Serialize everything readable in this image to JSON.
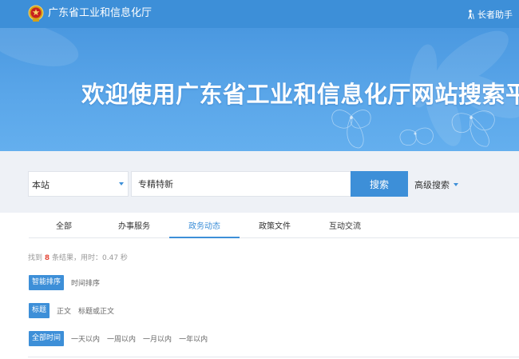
{
  "header": {
    "site_name": "广东省工业和信息化厅",
    "elder_assistant": "长者助手"
  },
  "banner": {
    "title": "欢迎使用广东省工业和信息化厅网站搜索平台"
  },
  "search": {
    "scope": "本站",
    "query": "专精特新",
    "button": "搜索",
    "advanced": "高级搜索"
  },
  "tabs": [
    {
      "label": "全部"
    },
    {
      "label": "办事服务"
    },
    {
      "label": "政务动态"
    },
    {
      "label": "政策文件"
    },
    {
      "label": "互动交流"
    }
  ],
  "active_tab": "政务动态",
  "results": {
    "prefix": "找到",
    "count": "8",
    "suffix": "条结果，用时：0.47 秒"
  },
  "sort": {
    "options": [
      "智能排序",
      "时间排序"
    ],
    "selected": "智能排序"
  },
  "field": {
    "options": [
      "标题",
      "正文",
      "标题或正文"
    ],
    "selected": "标题"
  },
  "time": {
    "options": [
      "全部时间",
      "一天以内",
      "一周以内",
      "一月以内",
      "一年以内"
    ],
    "selected": "全部时间"
  },
  "colors": {
    "primary": "#3d8fd8",
    "count": "#e44b3c",
    "search_bg": "#eef1f6"
  },
  "icons": {
    "emblem": "national-emblem-icon",
    "elder": "elder-person-icon",
    "dropdown": "caret-down-icon"
  }
}
